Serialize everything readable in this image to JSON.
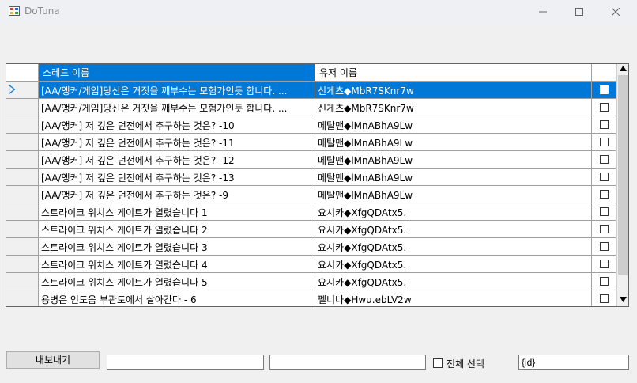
{
  "window": {
    "title": "DoTuna"
  },
  "grid": {
    "columns": {
      "thread": "스레드 이름",
      "user": "유저 이름"
    },
    "rows": [
      {
        "thread": "[AA/앵커/게임]당신은 거짓을 깨부수는 모험가인듯 합니다. ...",
        "user": "신게츠◆MbR7SKnr7w",
        "selected": true
      },
      {
        "thread": "[AA/앵커/게임]당신은 거짓을 깨부수는 모험가인듯 합니다. ...",
        "user": "신게츠◆MbR7SKnr7w"
      },
      {
        "thread": "[AA/앵커] 저 깊은 던전에서 추구하는 것은? -10",
        "user": "메탈맨◆lMnABhA9Lw"
      },
      {
        "thread": "[AA/앵커] 저 깊은 던전에서 추구하는 것은? -11",
        "user": "메탈맨◆lMnABhA9Lw"
      },
      {
        "thread": "[AA/앵커] 저 깊은 던전에서 추구하는 것은? -12",
        "user": "메탈맨◆lMnABhA9Lw"
      },
      {
        "thread": "[AA/앵커] 저 깊은 던전에서 추구하는 것은? -13",
        "user": "메탈맨◆lMnABhA9Lw"
      },
      {
        "thread": "[AA/앵커] 저 깊은 던전에서 추구하는 것은? -9",
        "user": "메탈맨◆lMnABhA9Lw"
      },
      {
        "thread": "스트라이크 위치스 게이트가 열렸습니다 1",
        "user": "요시카◆XfgQDAtx5."
      },
      {
        "thread": "스트라이크 위치스 게이트가 열렸습니다 2",
        "user": "요시카◆XfgQDAtx5."
      },
      {
        "thread": "스트라이크 위치스 게이트가 열렸습니다 3",
        "user": "요시카◆XfgQDAtx5."
      },
      {
        "thread": "스트라이크 위치스 게이트가 열렸습니다 4",
        "user": "요시카◆XfgQDAtx5."
      },
      {
        "thread": "스트라이크 위치스 게이트가 열렸습니다 5",
        "user": "요시카◆XfgQDAtx5."
      },
      {
        "thread": "용병은 인도움 부관토에서 살아간다 - 6",
        "user": "펠니나◆Hwu.ebLV2w"
      }
    ]
  },
  "footer": {
    "export_label": "내보내기",
    "input1_value": "",
    "input2_value": "",
    "select_all_label": "전체 선택",
    "id_value": "{id}"
  }
}
